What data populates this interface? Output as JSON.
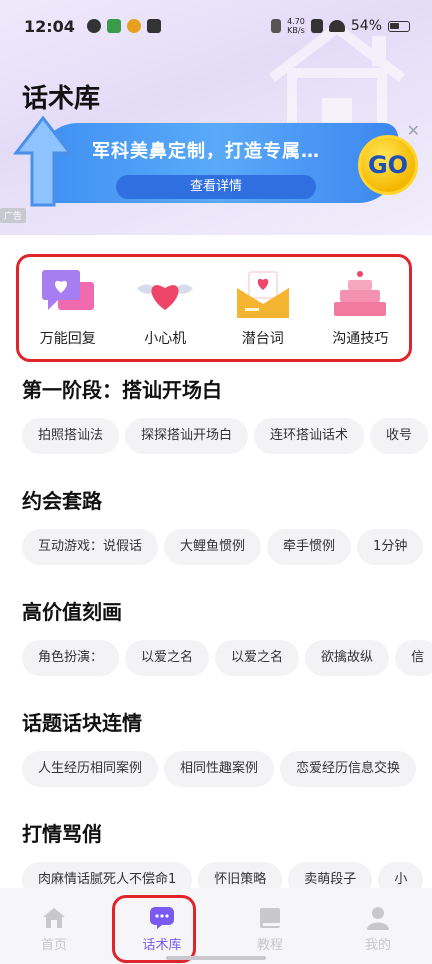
{
  "status_bar": {
    "time": "12:04",
    "net_speed_value": "4.70",
    "net_speed_unit": "KB/s",
    "battery": "54%"
  },
  "page_title": "话术库",
  "banner": {
    "text": "军科美鼻定制，打造专属…",
    "button_label": "查看详情",
    "go_label": "GO",
    "close_symbol": "✕",
    "ad_label": "广告"
  },
  "categories": [
    {
      "label": "万能回复",
      "icon": "chat-heart-icon"
    },
    {
      "label": "小心机",
      "icon": "winged-heart-icon"
    },
    {
      "label": "潜台词",
      "icon": "love-letter-icon"
    },
    {
      "label": "沟通技巧",
      "icon": "cake-icon"
    }
  ],
  "sections": [
    {
      "title": "第一阶段：搭讪开场白",
      "chips": [
        "拍照搭讪法",
        "探探搭讪开场白",
        "连环搭讪话术",
        "收号"
      ]
    },
    {
      "title": "约会套路",
      "chips": [
        "互动游戏：说假话",
        "大鲤鱼惯例",
        "牵手惯例",
        "1分钟"
      ]
    },
    {
      "title": "高价值刻画",
      "chips": [
        "角色扮演：",
        "以爱之名",
        "以爱之名",
        "欲擒故纵",
        "信"
      ]
    },
    {
      "title": "话题话块连情",
      "chips": [
        "人生经历相同案例",
        "相同性趣案例",
        "恋爱经历信息交换"
      ]
    },
    {
      "title": "打情骂俏",
      "chips": [
        "肉麻情话腻死人不偿命1",
        "怀旧策略",
        "卖萌段子",
        "小"
      ]
    }
  ],
  "bottom_nav": [
    {
      "label": "首页",
      "icon": "home-icon",
      "active": false
    },
    {
      "label": "话术库",
      "icon": "chat-bubble-icon",
      "active": true
    },
    {
      "label": "教程",
      "icon": "book-icon",
      "active": false
    },
    {
      "label": "我的",
      "icon": "person-icon",
      "active": false
    }
  ],
  "colors": {
    "accent": "#7a5af0",
    "highlight_border": "#e0242b",
    "banner_blue": "#4a9bf5",
    "chip_bg": "#f3f3f5"
  }
}
